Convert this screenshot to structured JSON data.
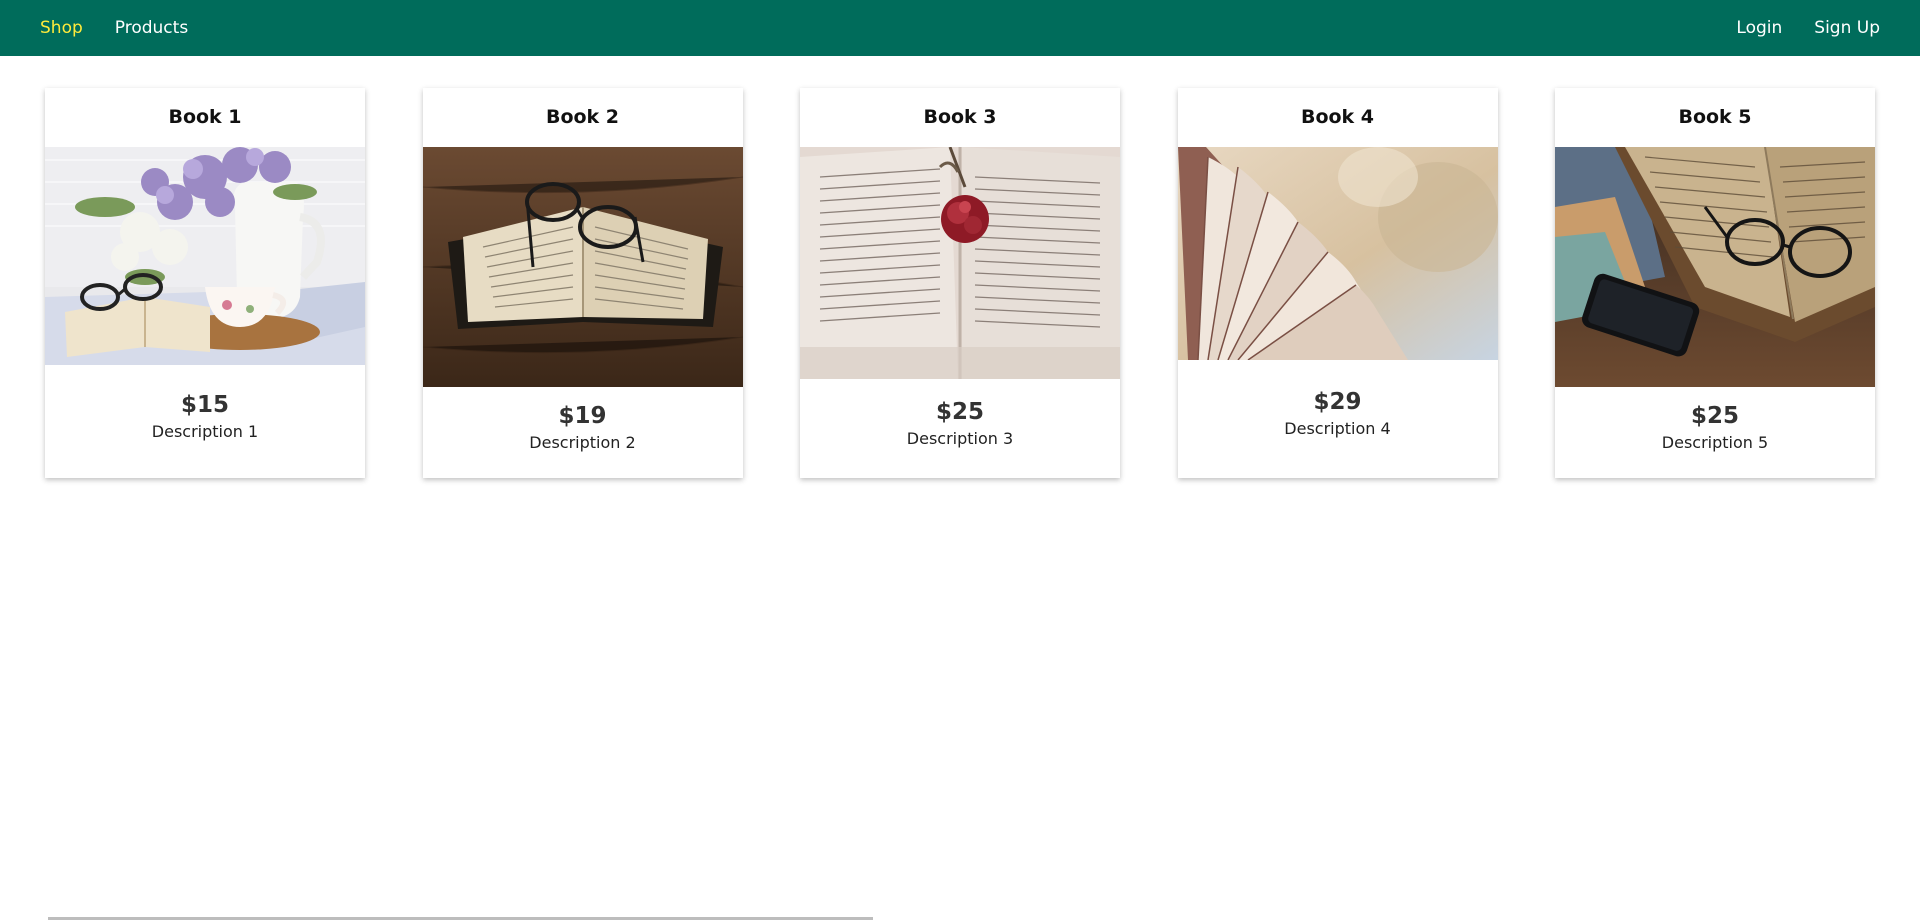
{
  "nav": {
    "left": [
      {
        "label": "Shop",
        "active": true
      },
      {
        "label": "Products",
        "active": false
      }
    ],
    "right": [
      {
        "label": "Login"
      },
      {
        "label": "Sign Up"
      }
    ]
  },
  "colors": {
    "navbar": "#006c5b",
    "active_link": "#ffeb3b"
  },
  "products": [
    {
      "title": "Book 1",
      "price": "$15",
      "description": "Description 1",
      "image": "book-with-glasses-teacup-and-lilacs"
    },
    {
      "title": "Book 2",
      "price": "$19",
      "description": "Description 2",
      "image": "open-book-with-glasses-on-wood"
    },
    {
      "title": "Book 3",
      "price": "$25",
      "description": "Description 3",
      "image": "open-book-with-rose"
    },
    {
      "title": "Book 4",
      "price": "$29",
      "description": "Description 4",
      "image": "fanned-book-pages"
    },
    {
      "title": "Book 5",
      "price": "$25",
      "description": "Description 5",
      "image": "book-glasses-and-phone"
    }
  ]
}
